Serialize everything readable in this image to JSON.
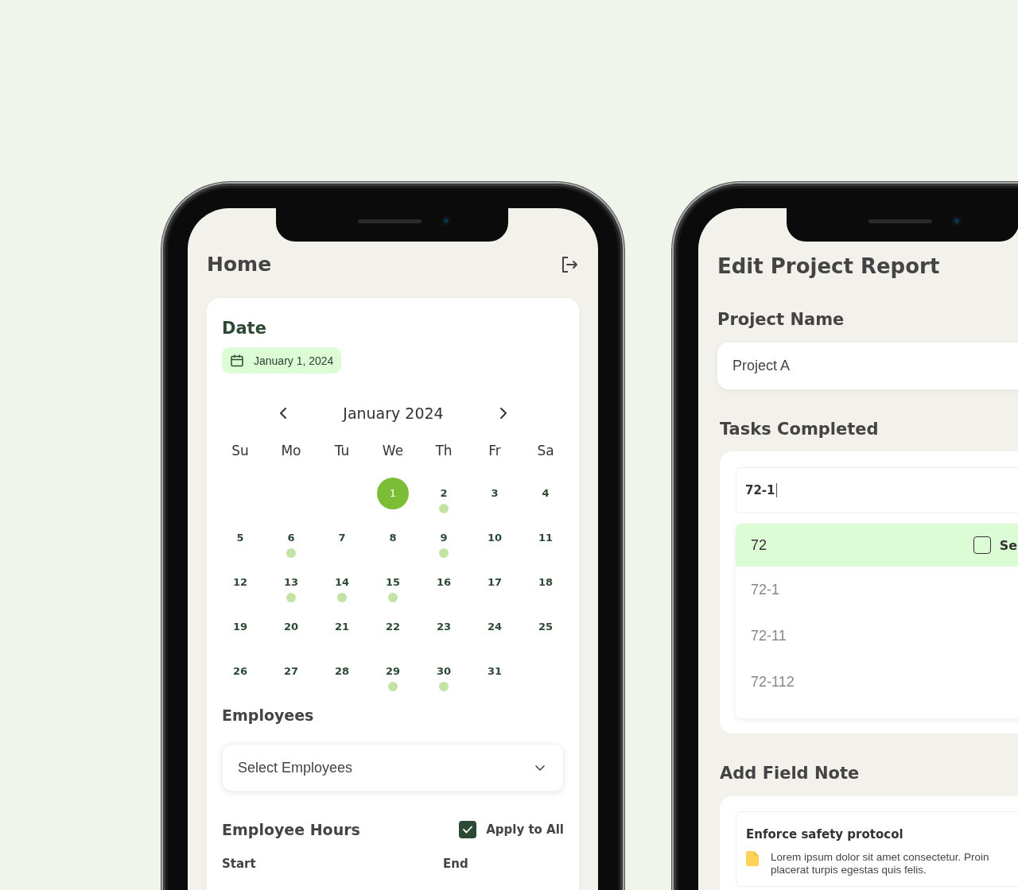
{
  "screens": [
    {
      "kind": "home",
      "title": "Home",
      "date_card": {
        "heading": "Date",
        "date_chip": "January 1, 2024",
        "month": "January 2024",
        "weekdays": [
          "Su",
          "Mo",
          "Tu",
          "We",
          "Th",
          "Fr",
          "Sa"
        ],
        "weeks": [
          {
            "days": [
              {
                "label": "1",
                "selected": true,
                "has_event": false
              },
              {
                "label": "2",
                "selected": false,
                "has_event": true
              },
              {
                "label": "3",
                "selected": false,
                "has_event": false
              },
              {
                "label": "4",
                "selected": false,
                "has_event": false
              }
            ]
          },
          {
            "days": [
              {
                "label": "5",
                "selected": false,
                "has_event": false
              },
              {
                "label": "6",
                "selected": false,
                "has_event": true
              },
              {
                "label": "7",
                "selected": false,
                "has_event": false
              },
              {
                "label": "8",
                "selected": false,
                "has_event": false
              },
              {
                "label": "9",
                "selected": false,
                "has_event": true
              },
              {
                "label": "10",
                "selected": false,
                "has_event": false
              },
              {
                "label": "11",
                "selected": false,
                "has_event": false
              }
            ]
          },
          {
            "days": [
              {
                "label": "12",
                "selected": false,
                "has_event": false
              },
              {
                "label": "13",
                "selected": false,
                "has_event": true
              },
              {
                "label": "14",
                "selected": false,
                "has_event": true
              },
              {
                "label": "15",
                "selected": false,
                "has_event": true
              },
              {
                "label": "16",
                "selected": false,
                "has_event": false
              },
              {
                "label": "17",
                "selected": false,
                "has_event": false
              },
              {
                "label": "18",
                "selected": false,
                "has_event": false
              }
            ]
          },
          {
            "days": [
              {
                "label": "19",
                "selected": false,
                "has_event": false
              },
              {
                "label": "20",
                "selected": false,
                "has_event": false
              },
              {
                "label": "21",
                "selected": false,
                "has_event": false
              },
              {
                "label": "22",
                "selected": false,
                "has_event": false
              },
              {
                "label": "23",
                "selected": false,
                "has_event": false
              },
              {
                "label": "24",
                "selected": false,
                "has_event": false
              },
              {
                "label": "25",
                "selected": false,
                "has_event": false
              }
            ]
          },
          {
            "days": [
              {
                "label": "26",
                "selected": false,
                "has_event": false
              },
              {
                "label": "27",
                "selected": false,
                "has_event": false
              },
              {
                "label": "28",
                "selected": false,
                "has_event": false
              },
              {
                "label": "29",
                "selected": false,
                "has_event": true
              },
              {
                "label": "30",
                "selected": false,
                "has_event": true
              },
              {
                "label": "31",
                "selected": false,
                "has_event": false
              }
            ]
          }
        ],
        "employees": {
          "heading": "Employees",
          "placeholder": "Select Employees"
        },
        "hours": {
          "heading": "Employee Hours",
          "apply_all": {
            "label": "Apply to All",
            "checked": true
          },
          "columns": [
            "Start",
            "End"
          ]
        }
      }
    },
    {
      "kind": "report",
      "title": "Edit Project Report",
      "project_name": {
        "label": "Project Name",
        "value": "Project A"
      },
      "tasks": {
        "label": "Tasks Completed",
        "search_value": "72-1",
        "options": [
          {
            "label": "72",
            "selected": true,
            "checkbox": {
              "checked": false,
              "label": "Se"
            }
          },
          {
            "label": "72-1",
            "selected": false
          },
          {
            "label": "72-11",
            "selected": false
          },
          {
            "label": "72-112",
            "selected": false
          }
        ]
      },
      "field_note": {
        "heading": "Add Field Note",
        "notes": [
          {
            "title": "Enforce safety protocol",
            "text": "Lorem ipsum dolor sit amet consectetur. Proin placerat turpis egestas quis felis."
          }
        ]
      }
    }
  ]
}
